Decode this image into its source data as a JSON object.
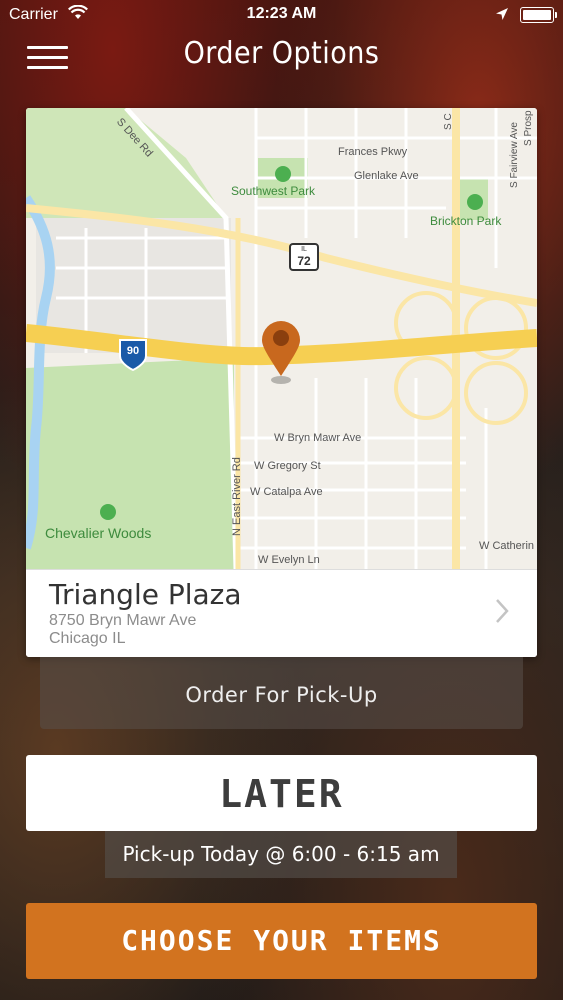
{
  "status_bar": {
    "carrier": "Carrier",
    "time": "12:23 AM"
  },
  "header": {
    "title": "Order Options"
  },
  "map": {
    "labels": {
      "s_dee_rd": "S Dee Rd",
      "frances_pkwy": "Frances Pkwy",
      "glenlake_ave": "Glenlake Ave",
      "southwest_park": "Southwest Park",
      "brickton_park": "Brickton Park",
      "fairview_ave": "S Fairview Ave",
      "s_c": "S C",
      "s_prosp": "S Prosp",
      "route_72_state": "IL",
      "route_72_num": "72",
      "interstate_90": "90",
      "bryn_mawr": "W Bryn Mawr Ave",
      "gregory": "W Gregory St",
      "catalpa": "W Catalpa Ave",
      "evelyn": "W Evelyn Ln",
      "catherine": "W Catherin",
      "east_river_rd": "N East River Rd",
      "chevalier_woods": "Chevalier Woods"
    }
  },
  "location": {
    "name": "Triangle Plaza",
    "address_line1": "8750 Bryn Mawr Ave",
    "address_line2": "Chicago IL"
  },
  "order_type_label": "Order For Pick-Up",
  "timing_label": "LATER",
  "pickup_time_label": "Pick-up Today @ 6:00 - 6:15 am",
  "cta_label": "CHOOSE YOUR ITEMS",
  "colors": {
    "accent": "#d2731f",
    "pin": "#c8681e",
    "highway": "#f6cf52",
    "park": "#c6e3b0"
  }
}
